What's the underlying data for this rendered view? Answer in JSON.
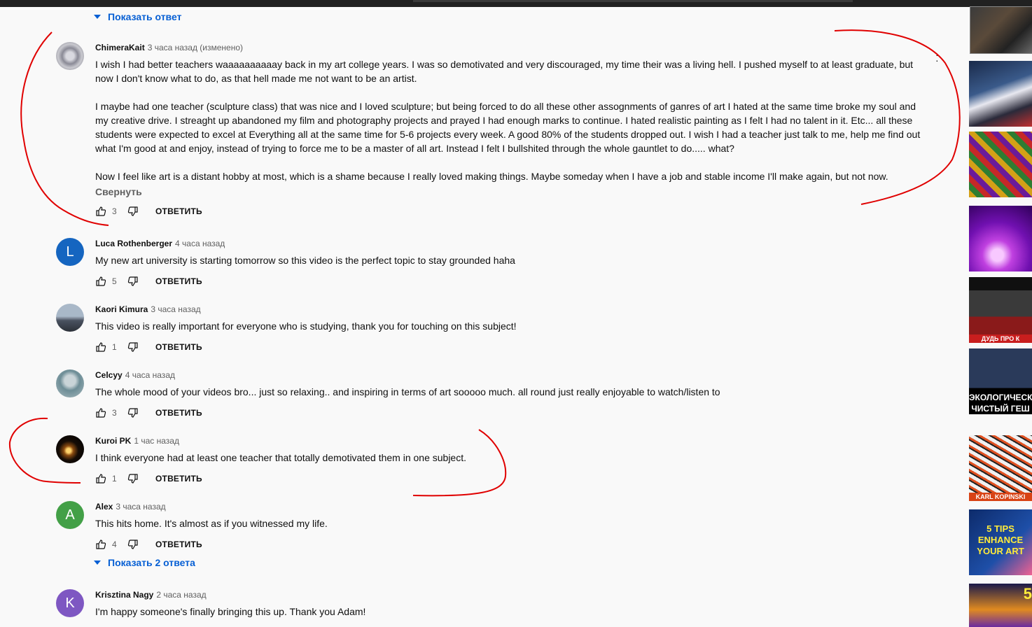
{
  "show_reply_top": "Показать ответ",
  "show_replies_alex": "Показать 2 ответа",
  "collapse_label": "Свернуть",
  "reply_label": "ОТВЕТИТЬ",
  "comments": [
    {
      "author": "ChimeraKait",
      "time": "3 часа назад (изменено)",
      "paragraphs": [
        "I wish I had better teachers waaaaaaaaaay back in my art college years. I was so demotivated and very discouraged, my time their was a living hell. I pushed myself to at least graduate, but now I don't know what to do, as that hell made me not want to be an artist.",
        "I maybe had one teacher (sculpture class) that was nice and I loved sculpture; but being forced to do all these other assognments of ganres of art I hated at the same time broke my soul and my creative drive. I streaght up abandoned my film and photography projects and prayed I had enough marks to continue. I hated realistic painting as I felt I had no talent in it. Etc... all these students were expected to excel at Everything all at the same time for 5-6 projects every week. A good 80% of the students dropped out. I wish I had a teacher just talk to me, help me find out what I'm good at and enjoy, instead of trying to force me to be a master of all art. Instead I felt I bullshited through the whole gauntlet to do..... what?",
        "Now I feel like art is a distant hobby at most, which is a shame because I really loved making things. Maybe someday when I have a job and stable income I'll make again, but not now."
      ],
      "likes": "3"
    },
    {
      "author": "Luca Rothenberger",
      "time": "4 часа назад",
      "avatar_letter": "L",
      "paragraphs": [
        "My new art university is starting tomorrow so this video is the perfect topic to stay grounded haha"
      ],
      "likes": "5"
    },
    {
      "author": "Kaori Kimura",
      "time": "3 часа назад",
      "paragraphs": [
        "This video is really important for everyone who is studying, thank you for touching on this subject!"
      ],
      "likes": "1"
    },
    {
      "author": "Celcyy",
      "time": "4 часа назад",
      "paragraphs": [
        "The whole mood of your videos bro... just so relaxing.. and inspiring in terms of art sooooo much. all round just really enjoyable to watch/listen to"
      ],
      "likes": "3"
    },
    {
      "author": "Kuroi PK",
      "time": "1 час назад",
      "paragraphs": [
        "I think everyone had at least one teacher that totally demotivated them in one subject."
      ],
      "likes": "1"
    },
    {
      "author": "Alex",
      "time": "3 часа назад",
      "avatar_letter": "A",
      "paragraphs": [
        "This hits home. It's almost as if you witnessed my life."
      ],
      "likes": "4"
    },
    {
      "author": "Krisztina Nagy",
      "time": "2 часа назад",
      "avatar_letter": "K",
      "paragraphs": [
        "I'm happy someone's finally bringing this up. Thank you Adam!"
      ]
    }
  ],
  "thumbnails": [
    {
      "caption": ""
    },
    {
      "caption": ""
    },
    {
      "caption": ""
    },
    {
      "caption": ""
    },
    {
      "caption": "ДУДЬ ПРО К"
    },
    {
      "caption": "ЭКОЛОГИЧЕСК ЧИСТЫЙ ГЕШ"
    },
    {
      "caption": "KARL KOPINSKI"
    },
    {
      "caption": "5 TIPS ENHANCE YOUR ART"
    },
    {
      "caption": "5"
    }
  ],
  "colors": {
    "link": "#065fd4",
    "annotation": "#e00000",
    "avatar_luca": "#1565c0",
    "avatar_alex": "#43a047",
    "avatar_krisztina": "#7e57c2"
  },
  "icons": [
    "like-icon",
    "dislike-icon",
    "caret-down-icon",
    "more-vert-icon"
  ]
}
